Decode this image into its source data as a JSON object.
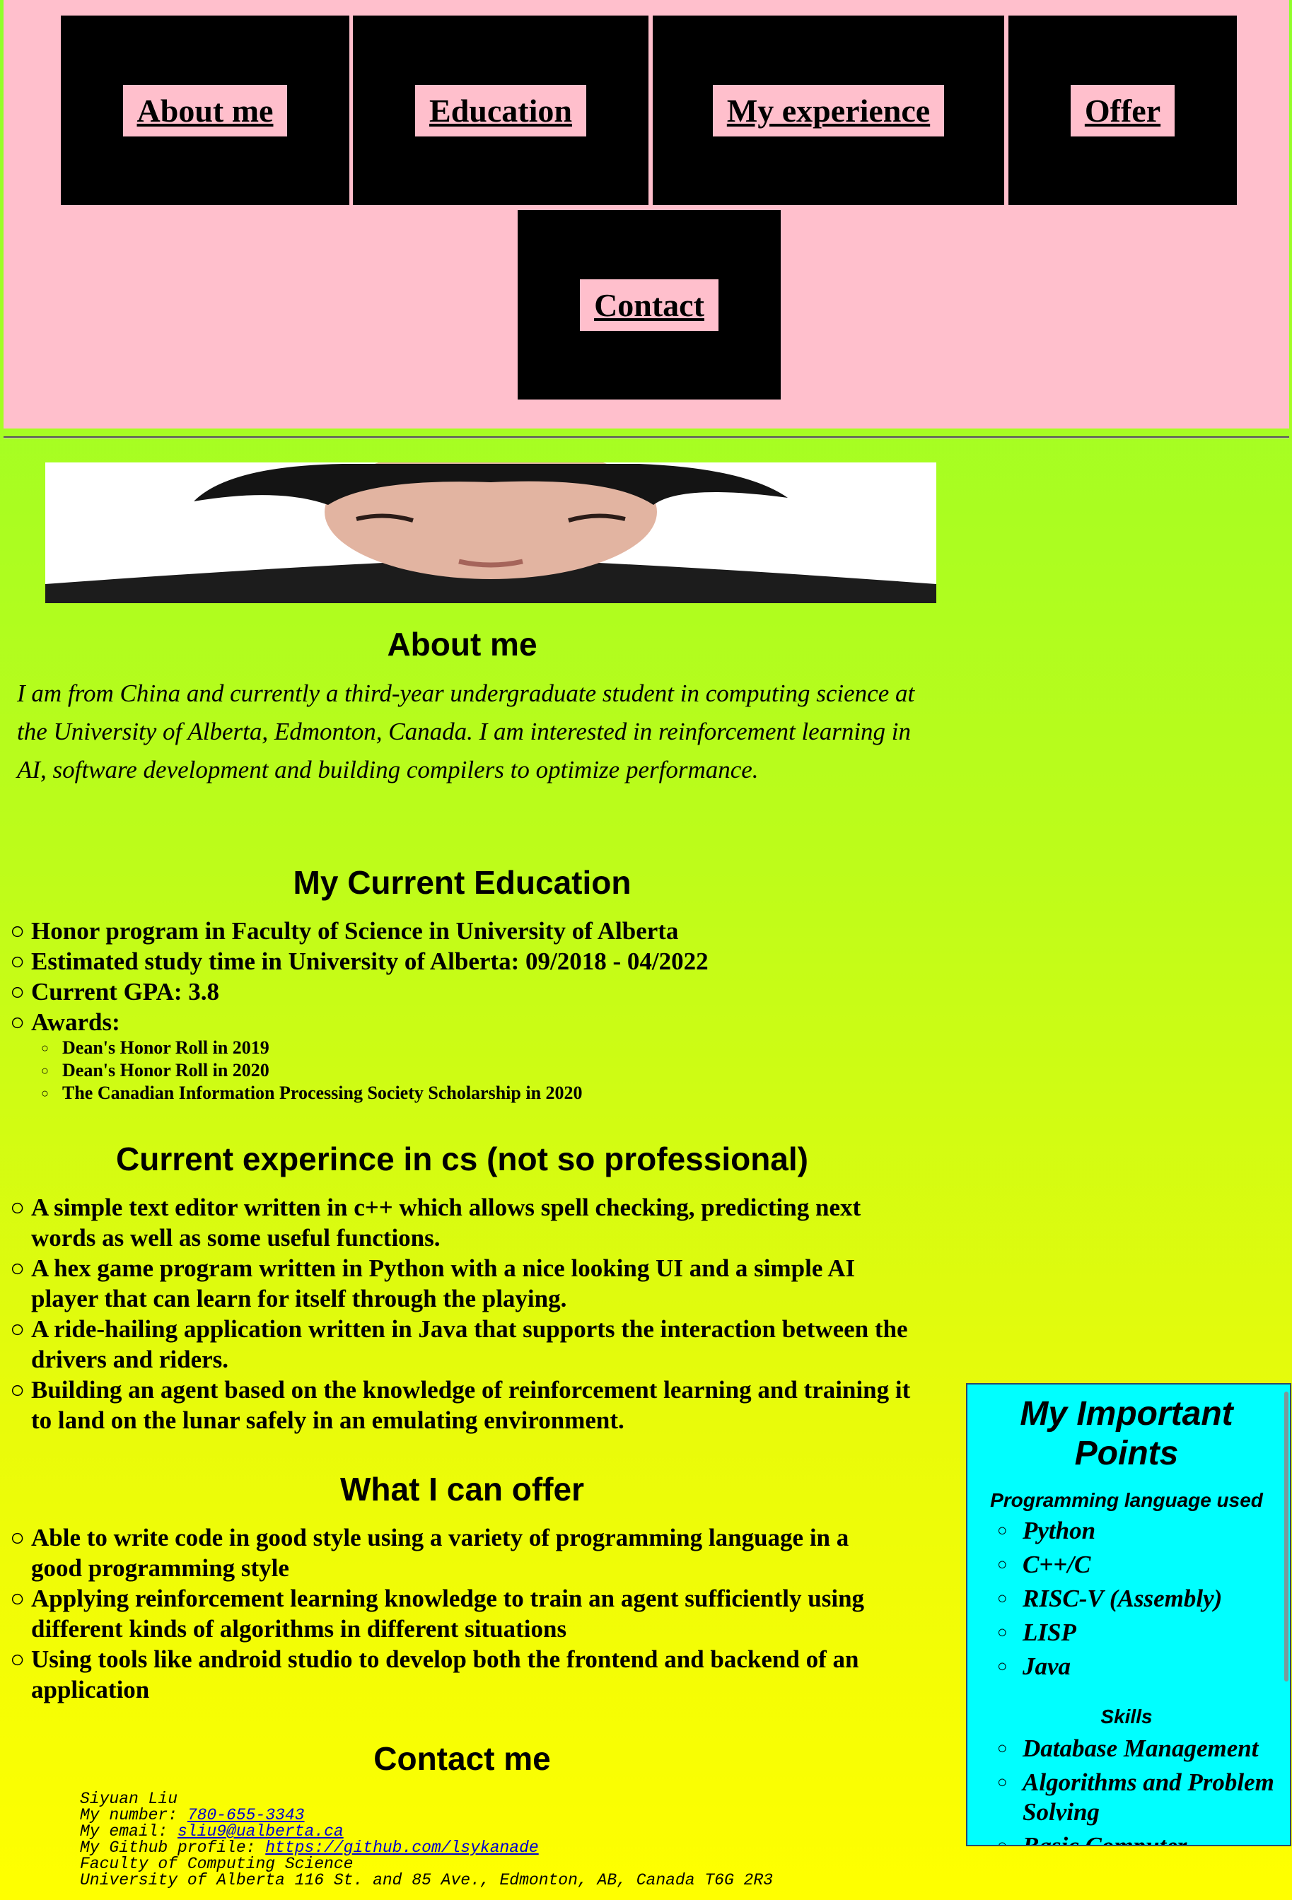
{
  "nav": {
    "about": "About me",
    "education": "Education",
    "experience": "My experience",
    "offer": "Offer",
    "contact": "Contact"
  },
  "about": {
    "heading": "About me",
    "text": "I am from China and currently a third-year undergraduate student in computing science at the University of Alberta, Edmonton, Canada. I am interested in reinforcement learning in AI, software development and building compilers to optimize performance."
  },
  "education": {
    "heading": "My Current Education",
    "items": [
      "Honor program in Faculty of Science in University of Alberta",
      "Estimated study time in University of Alberta: 09/2018 - 04/2022",
      "Current GPA: 3.8",
      "Awards:"
    ],
    "awards": [
      "Dean's Honor Roll in 2019",
      "Dean's Honor Roll in 2020",
      "The Canadian Information Processing Society Scholarship in 2020"
    ]
  },
  "experience": {
    "heading": "Current experince in cs (not so professional)",
    "items": [
      "A simple text editor written in c++ which allows spell checking, predicting next words as well as some useful functions.",
      "A hex game program written in Python with a nice looking UI and a simple AI player that can learn for itself through the playing.",
      "A ride-hailing application written in Java that supports the interaction between the drivers and riders.",
      "Building an agent based on the knowledge of reinforcement learning and training it to land on the lunar safely in an emulating environment."
    ]
  },
  "offer": {
    "heading": "What I can offer",
    "items": [
      "Able to write code in good style using a variety of programming language in a good programming style",
      "Applying reinforcement learning knowledge to train an agent sufficiently using different kinds of algorithms in different situations",
      "Using tools like android studio to develop both the frontend and backend of an application"
    ]
  },
  "contact": {
    "heading": "Contact me",
    "name": "Siyuan Liu",
    "number_label": "My number: ",
    "number": "780-655-3343",
    "email_label": "My email: ",
    "email": "sliu9@ualberta.ca",
    "github_label": "My Github profile: ",
    "github": "https://github.com/lsykanade",
    "faculty": "Faculty of Computing Science",
    "address": "University of Alberta 116 St. and 85 Ave., Edmonton, AB, Canada T6G 2R3"
  },
  "aside": {
    "title": "My Important Points",
    "languages_heading": "Programming language used",
    "languages": [
      "Python",
      "C++/C",
      "RISC-V (Assembly)",
      "LISP",
      "Java"
    ],
    "skills_heading": "Skills",
    "skills": [
      "Database Management",
      "Algorithms and Problem Solving",
      "Basic Computer"
    ]
  },
  "colors": {
    "header_bg": "#ffbfcc",
    "nav_box": "#000000",
    "aside_bg": "#00ffff",
    "link": "#0000cc"
  }
}
